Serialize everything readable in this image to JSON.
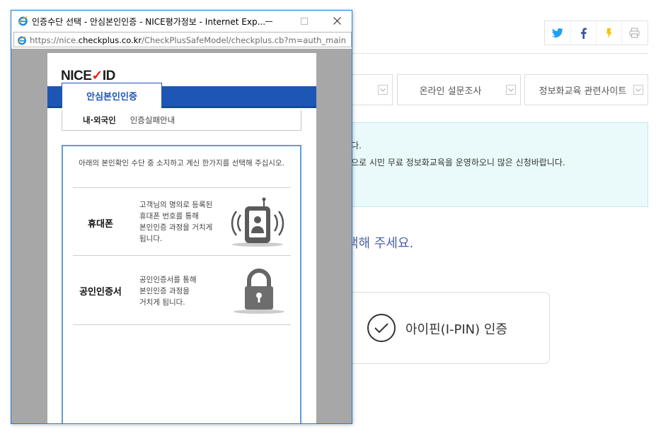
{
  "background": {
    "share_icons": [
      "twitter-icon",
      "facebook-icon",
      "kakaostory-icon",
      "print-icon"
    ],
    "dropdowns": [
      {
        "label": ""
      },
      {
        "label": "온라인 설문조사"
      },
      {
        "label": "정보화교육 관련사이트"
      }
    ],
    "notice": {
      "line1": "다.",
      "line2": "으로 시민 무료 정보화교육을 운영하오니 많은 신청바랍니다."
    },
    "heading": "택해 주세요.",
    "ipin_label": "아이핀(I-PIN) 인증",
    "colors": {
      "heading": "#4a63a8",
      "notice_bg": "#eafafa",
      "twitter": "#1da1f2",
      "facebook": "#3b5998",
      "kakao": "#f5c400"
    }
  },
  "popup": {
    "title": "인증수단 선택 - 안심본인인증 - NICE평가정보 - Internet Exp...",
    "url_prefix": "https://nice.",
    "url_domain": "checkplus.co.kr",
    "url_path": "/CheckPlusSafeModel/checkplus.cb?m=auth_main",
    "logo_text_a": "NICE",
    "logo_text_b": "ID",
    "tab_label": "안심본인인증",
    "subtab_1": "내·외국인",
    "subtab_2": "인증실패안내",
    "intro": "아래의 본인확인 수단 중 소지하고 계신 한가지를 선택해 주십시오.",
    "options": [
      {
        "name": "휴대폰",
        "desc_lines": [
          "고객님의 명의로 등록된",
          "휴대폰 번호를 통해",
          "본인인증 과정을 거치게",
          "됩니다."
        ],
        "icon": "mobile-phone-icon"
      },
      {
        "name": "공인인증서",
        "desc_lines": [
          "공인인증서를 통해",
          "본인인증 과정을",
          "거치게 됩니다."
        ],
        "icon": "padlock-icon"
      }
    ],
    "colors": {
      "brand_blue": "#1d56b5",
      "frame": "#1a7fd4"
    }
  }
}
